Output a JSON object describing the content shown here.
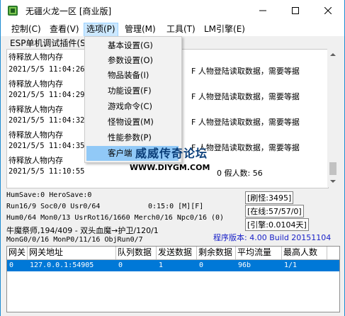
{
  "window": {
    "title": "无疆火龙一区 [商业版]",
    "minimize": "minimize",
    "maximize": "maximize",
    "close": "close"
  },
  "menubar": {
    "items": [
      {
        "label": "控制(C)"
      },
      {
        "label": "查看(V)"
      },
      {
        "label": "选项(P)"
      },
      {
        "label": "管理(M)"
      },
      {
        "label": "工具(T)"
      },
      {
        "label": "LM引擎(E)"
      }
    ]
  },
  "tab": {
    "label": "ESP单机调试插件(S"
  },
  "options_menu": {
    "items": [
      {
        "label": "基本设置(G)"
      },
      {
        "label": "参数设置(O)"
      },
      {
        "label": "物品装备(I)"
      },
      {
        "label": "功能设置(F)"
      },
      {
        "label": "游戏命令(C)"
      },
      {
        "label": "怪物设置(M)"
      },
      {
        "label": "性能参数(P)"
      },
      {
        "label": "客户端"
      }
    ]
  },
  "log": {
    "lines": [
      {
        "time": "",
        "text": "待释放人物内存"
      },
      {
        "time": "2021/5/5 11:04:26",
        "text": "F 人物登陆读取数据，需要等据"
      },
      {
        "time": "",
        "text": "待释放人物内存"
      },
      {
        "time": "2021/5/5 11:04:29",
        "text": "F 人物登陆读取数据，需要等据"
      },
      {
        "time": "",
        "text": "待释放人物内存"
      },
      {
        "time": "2021/5/5 11:04:32",
        "text": "F 人物登陆读取数据，需要等据"
      },
      {
        "time": "",
        "text": "待释放人物内存"
      },
      {
        "time": "2021/5/5 11:04:35",
        "text": "F 人物登陆读取数据，需要等据"
      },
      {
        "time": "",
        "text": "待释放人物内存"
      },
      {
        "time": "2021/5/5 11:10:55",
        "text": "0 假人数: 56"
      }
    ]
  },
  "status": {
    "line1": "HumSave:0 HeroSave:0",
    "line2": "Run16/9 Soc0/0 Usr0/64",
    "line2b": "0:15:0 [M][F]",
    "line3": "Hum0/64 Mon0/13 UsrRot16/1660 Merch0/16 Npc0/16 (0)",
    "line4": "牛魔祭师,194/409 - 双头血魔→护卫/120/1",
    "line5": "MonG0/0/16 MonP0/11/16 ObjRun0/7",
    "refresh": "[刷怪:3495]",
    "online": "[在线:57/57/0]",
    "engine": "[引擎:0.0104天]",
    "version": "程序版本: 4.00 Build 20151104"
  },
  "table": {
    "headers": [
      "网关",
      "网关地址",
      "队列数据",
      "发送数据",
      "剩余数据",
      "平均流量",
      "最高人数"
    ],
    "rows": [
      [
        "0",
        "127.0.0.1:54905",
        "0",
        "1",
        "0",
        "96b",
        "1/1"
      ]
    ]
  },
  "watermark": {
    "cn": "威威传奇论坛",
    "en": "WWW.DIYGM.COM"
  },
  "colors": {
    "selection": "#0078d7",
    "menu_hover": "#91c9f7",
    "version_text": "#1a22c8"
  }
}
